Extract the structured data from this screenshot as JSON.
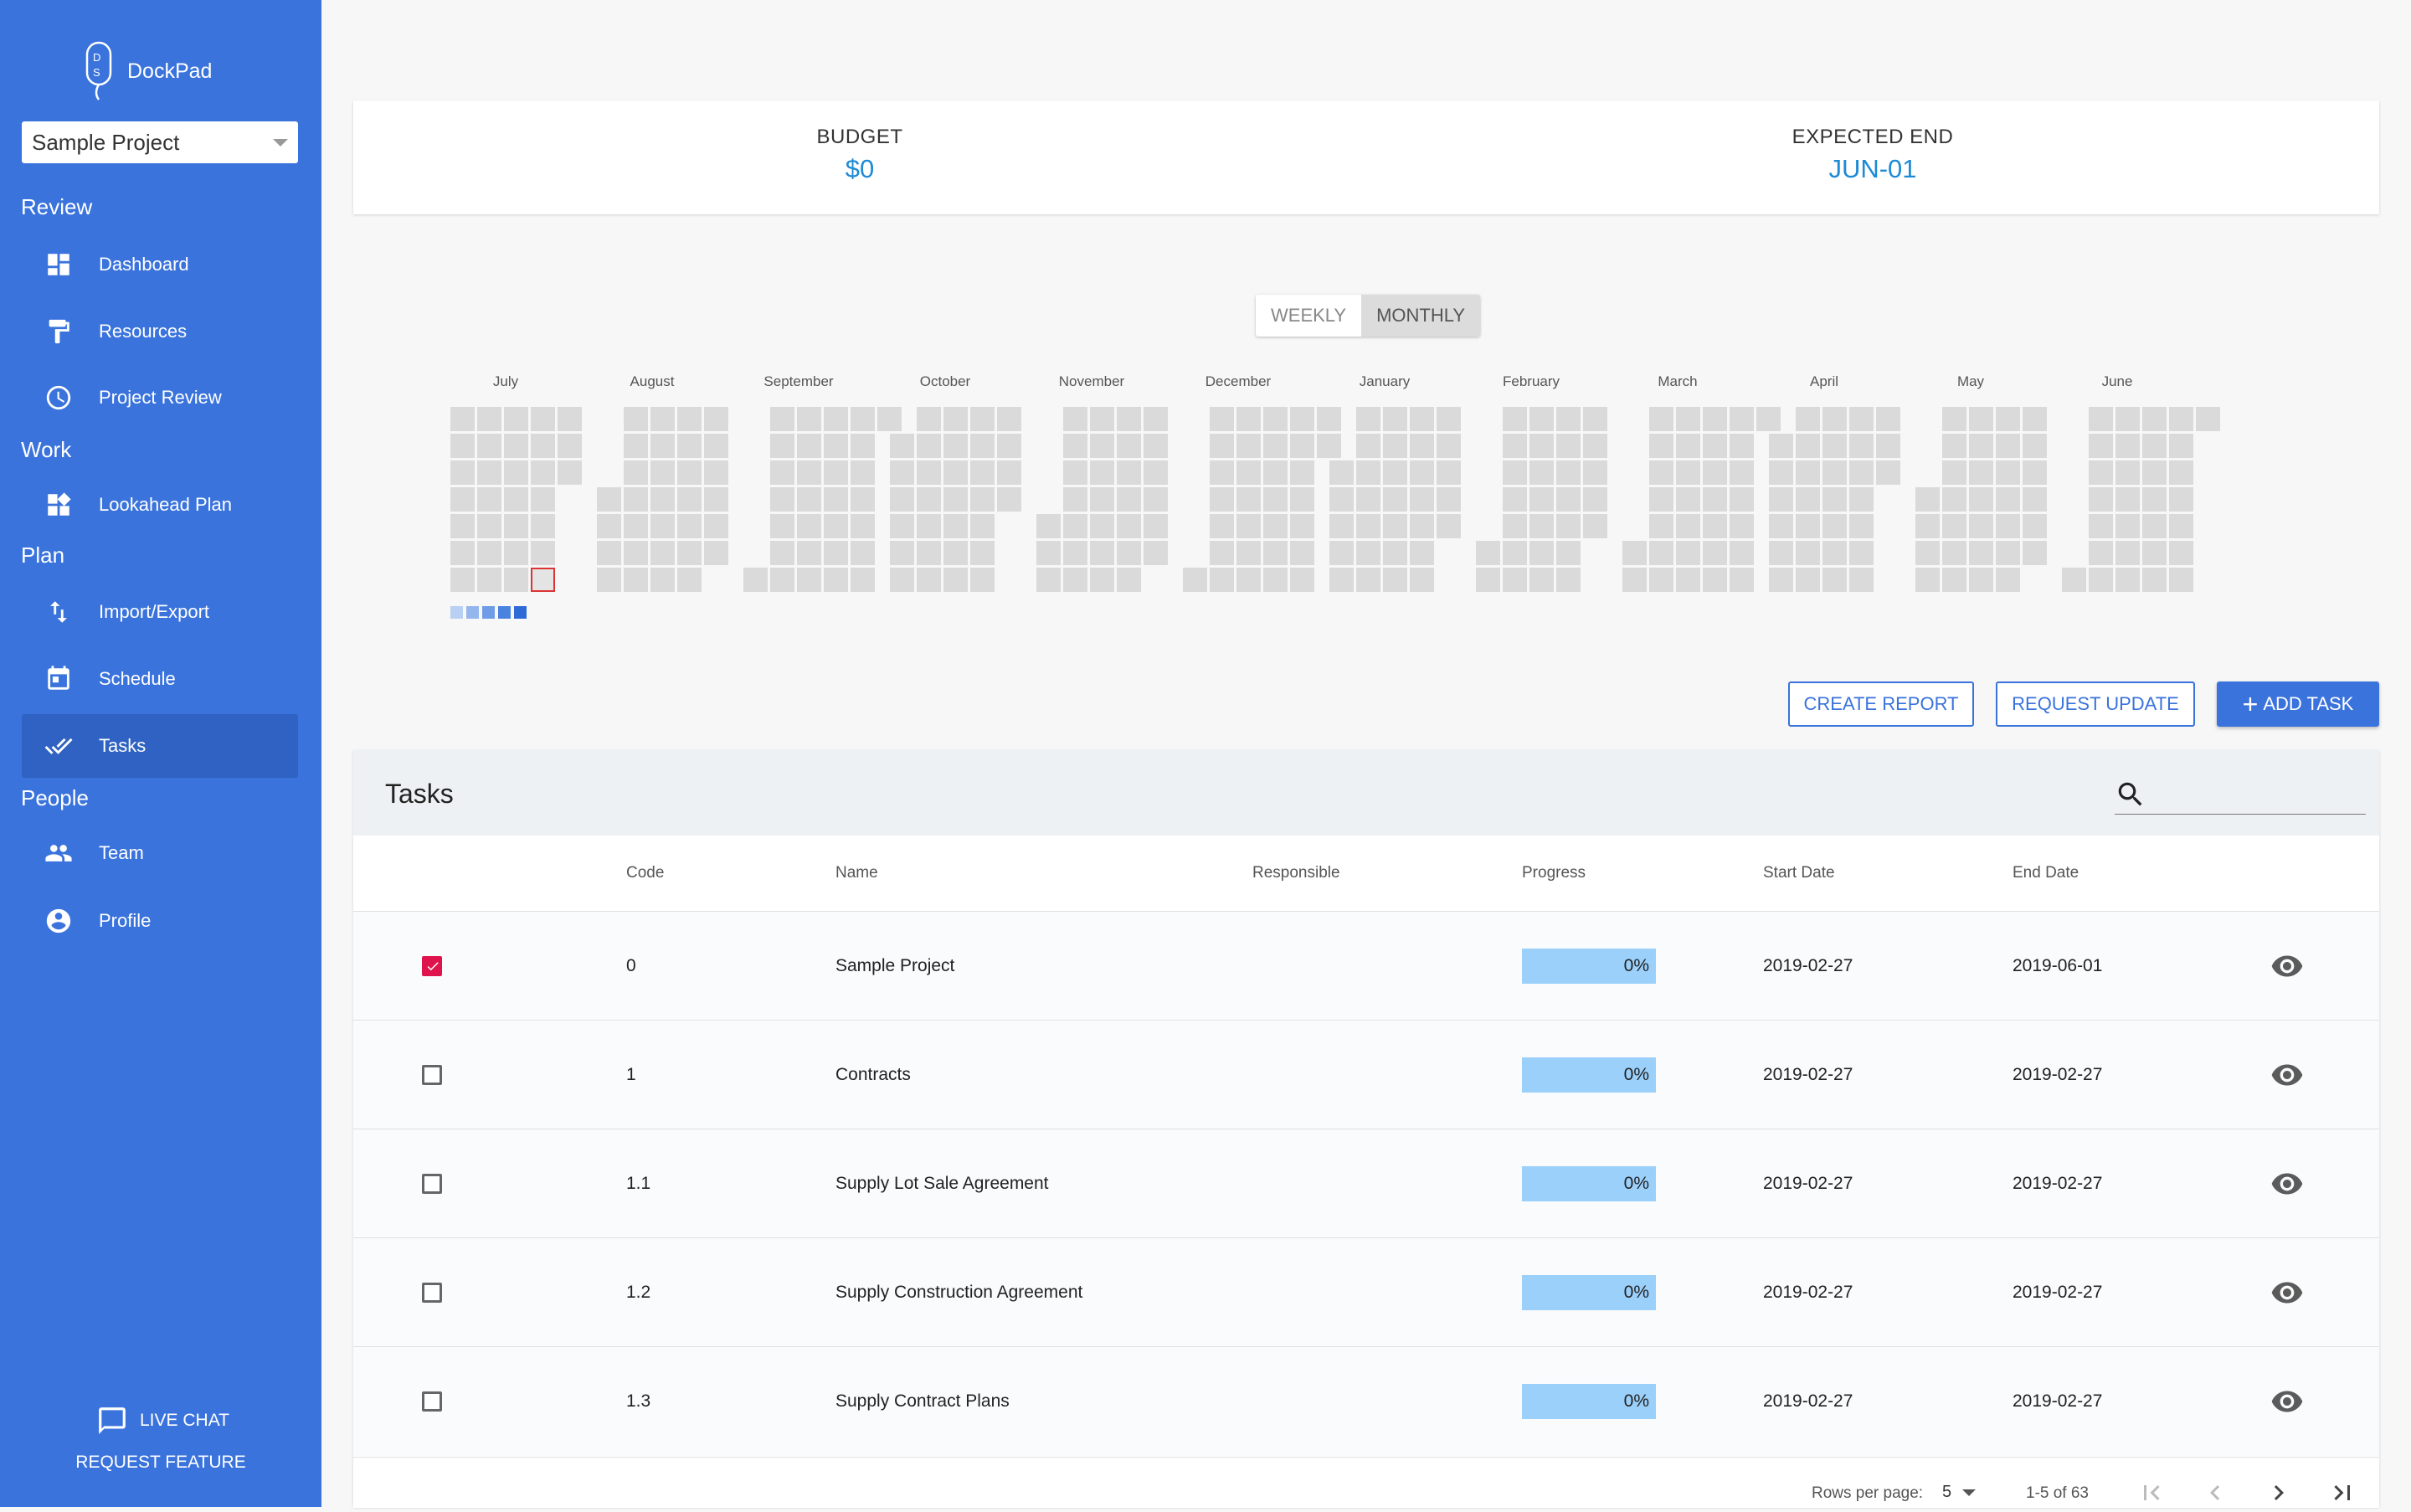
{
  "app": {
    "name": "DockPad",
    "project": "Sample Project"
  },
  "sidebar": {
    "sections": [
      {
        "title": "Review"
      },
      {
        "title": "Work"
      },
      {
        "title": "Plan"
      },
      {
        "title": "People"
      }
    ],
    "items": [
      {
        "label": "Dashboard",
        "icon": "dashboard-icon"
      },
      {
        "label": "Resources",
        "icon": "paint-roller-icon"
      },
      {
        "label": "Project Review",
        "icon": "clock-icon"
      },
      {
        "label": "Lookahead Plan",
        "icon": "widgets-icon"
      },
      {
        "label": "Import/Export",
        "icon": "import-export-icon"
      },
      {
        "label": "Schedule",
        "icon": "calendar-icon"
      },
      {
        "label": "Tasks",
        "icon": "double-check-icon",
        "active": true
      },
      {
        "label": "Team",
        "icon": "people-icon"
      },
      {
        "label": "Profile",
        "icon": "account-circle-icon"
      }
    ],
    "live_chat": "LIVE CHAT",
    "request_feature": "REQUEST FEATURE"
  },
  "summary": {
    "budget_label": "BUDGET",
    "budget_value": "$0",
    "end_label": "EXPECTED END",
    "end_value": "JUN-01"
  },
  "view_toggle": {
    "weekly": "WEEKLY",
    "monthly": "MONTHLY",
    "selected": "MONTHLY"
  },
  "calendar": {
    "months": [
      "July",
      "August",
      "September",
      "October",
      "November",
      "December",
      "January",
      "February",
      "March",
      "April",
      "May",
      "June"
    ]
  },
  "actions": {
    "create_report": "CREATE REPORT",
    "request_update": "REQUEST UPDATE",
    "add_task": "ADD TASK"
  },
  "tasks": {
    "title": "Tasks",
    "search_placeholder": "",
    "columns": [
      "Code",
      "Name",
      "Responsible",
      "Progress",
      "Start Date",
      "End Date"
    ],
    "rows": [
      {
        "checked": true,
        "code": "0",
        "name": "Sample Project",
        "responsible": "",
        "progress": "0%",
        "start": "2019-02-27",
        "end": "2019-06-01"
      },
      {
        "checked": false,
        "code": "1",
        "name": "Contracts",
        "responsible": "",
        "progress": "0%",
        "start": "2019-02-27",
        "end": "2019-02-27"
      },
      {
        "checked": false,
        "code": "1.1",
        "name": "Supply Lot Sale Agreement",
        "responsible": "",
        "progress": "0%",
        "start": "2019-02-27",
        "end": "2019-02-27"
      },
      {
        "checked": false,
        "code": "1.2",
        "name": "Supply Construction Agreement",
        "responsible": "",
        "progress": "0%",
        "start": "2019-02-27",
        "end": "2019-02-27"
      },
      {
        "checked": false,
        "code": "1.3",
        "name": "Supply Contract Plans",
        "responsible": "",
        "progress": "0%",
        "start": "2019-02-27",
        "end": "2019-02-27"
      }
    ],
    "footer": {
      "rows_per_page_label": "Rows per page:",
      "rows_per_page": "5",
      "range": "1-5 of 63"
    }
  },
  "colors": {
    "sidebar": "#3a73dc",
    "accent": "#1d8ad6",
    "checkbox": "#e0144c",
    "progress": "#9bd0fb"
  }
}
